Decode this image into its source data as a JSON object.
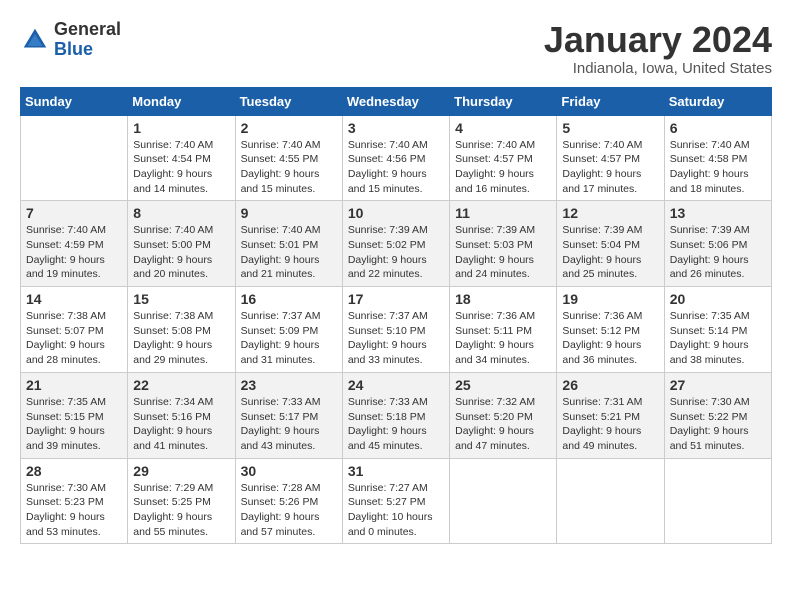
{
  "logo": {
    "general": "General",
    "blue": "Blue"
  },
  "header": {
    "month": "January 2024",
    "location": "Indianola, Iowa, United States"
  },
  "weekdays": [
    "Sunday",
    "Monday",
    "Tuesday",
    "Wednesday",
    "Thursday",
    "Friday",
    "Saturday"
  ],
  "weeks": [
    [
      {
        "day": "",
        "sunrise": "",
        "sunset": "",
        "daylight": ""
      },
      {
        "day": "1",
        "sunrise": "Sunrise: 7:40 AM",
        "sunset": "Sunset: 4:54 PM",
        "daylight": "Daylight: 9 hours and 14 minutes."
      },
      {
        "day": "2",
        "sunrise": "Sunrise: 7:40 AM",
        "sunset": "Sunset: 4:55 PM",
        "daylight": "Daylight: 9 hours and 15 minutes."
      },
      {
        "day": "3",
        "sunrise": "Sunrise: 7:40 AM",
        "sunset": "Sunset: 4:56 PM",
        "daylight": "Daylight: 9 hours and 15 minutes."
      },
      {
        "day": "4",
        "sunrise": "Sunrise: 7:40 AM",
        "sunset": "Sunset: 4:57 PM",
        "daylight": "Daylight: 9 hours and 16 minutes."
      },
      {
        "day": "5",
        "sunrise": "Sunrise: 7:40 AM",
        "sunset": "Sunset: 4:57 PM",
        "daylight": "Daylight: 9 hours and 17 minutes."
      },
      {
        "day": "6",
        "sunrise": "Sunrise: 7:40 AM",
        "sunset": "Sunset: 4:58 PM",
        "daylight": "Daylight: 9 hours and 18 minutes."
      }
    ],
    [
      {
        "day": "7",
        "sunrise": "Sunrise: 7:40 AM",
        "sunset": "Sunset: 4:59 PM",
        "daylight": "Daylight: 9 hours and 19 minutes."
      },
      {
        "day": "8",
        "sunrise": "Sunrise: 7:40 AM",
        "sunset": "Sunset: 5:00 PM",
        "daylight": "Daylight: 9 hours and 20 minutes."
      },
      {
        "day": "9",
        "sunrise": "Sunrise: 7:40 AM",
        "sunset": "Sunset: 5:01 PM",
        "daylight": "Daylight: 9 hours and 21 minutes."
      },
      {
        "day": "10",
        "sunrise": "Sunrise: 7:39 AM",
        "sunset": "Sunset: 5:02 PM",
        "daylight": "Daylight: 9 hours and 22 minutes."
      },
      {
        "day": "11",
        "sunrise": "Sunrise: 7:39 AM",
        "sunset": "Sunset: 5:03 PM",
        "daylight": "Daylight: 9 hours and 24 minutes."
      },
      {
        "day": "12",
        "sunrise": "Sunrise: 7:39 AM",
        "sunset": "Sunset: 5:04 PM",
        "daylight": "Daylight: 9 hours and 25 minutes."
      },
      {
        "day": "13",
        "sunrise": "Sunrise: 7:39 AM",
        "sunset": "Sunset: 5:06 PM",
        "daylight": "Daylight: 9 hours and 26 minutes."
      }
    ],
    [
      {
        "day": "14",
        "sunrise": "Sunrise: 7:38 AM",
        "sunset": "Sunset: 5:07 PM",
        "daylight": "Daylight: 9 hours and 28 minutes."
      },
      {
        "day": "15",
        "sunrise": "Sunrise: 7:38 AM",
        "sunset": "Sunset: 5:08 PM",
        "daylight": "Daylight: 9 hours and 29 minutes."
      },
      {
        "day": "16",
        "sunrise": "Sunrise: 7:37 AM",
        "sunset": "Sunset: 5:09 PM",
        "daylight": "Daylight: 9 hours and 31 minutes."
      },
      {
        "day": "17",
        "sunrise": "Sunrise: 7:37 AM",
        "sunset": "Sunset: 5:10 PM",
        "daylight": "Daylight: 9 hours and 33 minutes."
      },
      {
        "day": "18",
        "sunrise": "Sunrise: 7:36 AM",
        "sunset": "Sunset: 5:11 PM",
        "daylight": "Daylight: 9 hours and 34 minutes."
      },
      {
        "day": "19",
        "sunrise": "Sunrise: 7:36 AM",
        "sunset": "Sunset: 5:12 PM",
        "daylight": "Daylight: 9 hours and 36 minutes."
      },
      {
        "day": "20",
        "sunrise": "Sunrise: 7:35 AM",
        "sunset": "Sunset: 5:14 PM",
        "daylight": "Daylight: 9 hours and 38 minutes."
      }
    ],
    [
      {
        "day": "21",
        "sunrise": "Sunrise: 7:35 AM",
        "sunset": "Sunset: 5:15 PM",
        "daylight": "Daylight: 9 hours and 39 minutes."
      },
      {
        "day": "22",
        "sunrise": "Sunrise: 7:34 AM",
        "sunset": "Sunset: 5:16 PM",
        "daylight": "Daylight: 9 hours and 41 minutes."
      },
      {
        "day": "23",
        "sunrise": "Sunrise: 7:33 AM",
        "sunset": "Sunset: 5:17 PM",
        "daylight": "Daylight: 9 hours and 43 minutes."
      },
      {
        "day": "24",
        "sunrise": "Sunrise: 7:33 AM",
        "sunset": "Sunset: 5:18 PM",
        "daylight": "Daylight: 9 hours and 45 minutes."
      },
      {
        "day": "25",
        "sunrise": "Sunrise: 7:32 AM",
        "sunset": "Sunset: 5:20 PM",
        "daylight": "Daylight: 9 hours and 47 minutes."
      },
      {
        "day": "26",
        "sunrise": "Sunrise: 7:31 AM",
        "sunset": "Sunset: 5:21 PM",
        "daylight": "Daylight: 9 hours and 49 minutes."
      },
      {
        "day": "27",
        "sunrise": "Sunrise: 7:30 AM",
        "sunset": "Sunset: 5:22 PM",
        "daylight": "Daylight: 9 hours and 51 minutes."
      }
    ],
    [
      {
        "day": "28",
        "sunrise": "Sunrise: 7:30 AM",
        "sunset": "Sunset: 5:23 PM",
        "daylight": "Daylight: 9 hours and 53 minutes."
      },
      {
        "day": "29",
        "sunrise": "Sunrise: 7:29 AM",
        "sunset": "Sunset: 5:25 PM",
        "daylight": "Daylight: 9 hours and 55 minutes."
      },
      {
        "day": "30",
        "sunrise": "Sunrise: 7:28 AM",
        "sunset": "Sunset: 5:26 PM",
        "daylight": "Daylight: 9 hours and 57 minutes."
      },
      {
        "day": "31",
        "sunrise": "Sunrise: 7:27 AM",
        "sunset": "Sunset: 5:27 PM",
        "daylight": "Daylight: 10 hours and 0 minutes."
      },
      {
        "day": "",
        "sunrise": "",
        "sunset": "",
        "daylight": ""
      },
      {
        "day": "",
        "sunrise": "",
        "sunset": "",
        "daylight": ""
      },
      {
        "day": "",
        "sunrise": "",
        "sunset": "",
        "daylight": ""
      }
    ]
  ]
}
